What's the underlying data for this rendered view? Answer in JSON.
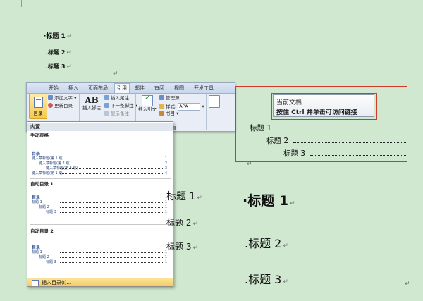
{
  "document": {
    "headings_top": [
      "标题 1",
      "标题 2",
      "标题 3"
    ],
    "headings_left": [
      "标题 1",
      "标题 2",
      "标题 3"
    ],
    "headings_right": [
      "标题 1",
      "标题 2",
      "标题 3"
    ],
    "paragraph_mark": "↵"
  },
  "ribbon": {
    "tabs": [
      "开始",
      "插入",
      "页面布局",
      "引用",
      "邮件",
      "审阅",
      "视图",
      "开发工具"
    ],
    "active_tab": "引用",
    "toc_button": "目录",
    "add_text": "添加文字",
    "update_toc": "更新目录",
    "footnote_big": "AB",
    "insert_footnote": "插入脚注",
    "insert_endnote": "插入尾注",
    "next_footnote": "下一条脚注",
    "show_notes": "显示备注",
    "insert_citation": "插入引文",
    "manage_sources": "管理源",
    "style_label": "样式:",
    "style_value": "APA",
    "bibliography": "书目",
    "group_label": "书目"
  },
  "gallery": {
    "header_builtin": "内置",
    "manual_table": "手动表格",
    "manual_title": "目录",
    "manual_lines": [
      "键入章标题(第 1 级)",
      "键入章标题(第 2 级)",
      "键入章标题(第 3 级)",
      "键入章标题(第 1 级)"
    ],
    "manual_pages": [
      "1",
      "2",
      "3",
      "4"
    ],
    "auto1": "自动目录 1",
    "auto1_title": "目录",
    "auto1_lines": [
      "标题 1",
      "标题 2",
      "标题 3"
    ],
    "auto1_pages": [
      "1",
      "1",
      "1"
    ],
    "auto2": "自动目录 2",
    "auto2_title": "目录",
    "auto2_lines": [
      "标题 1",
      "标题 2",
      "标题 3"
    ],
    "auto2_pages": [
      "1",
      "1",
      "1"
    ],
    "insert_toc": "插入目录(I)..."
  },
  "toc_right": {
    "tooltip_line1": "当前文档",
    "tooltip_line2": "按住 Ctrl 并单击可访问链接",
    "rows": [
      "标题 1",
      "标题 2",
      "标题 3"
    ],
    "accent_color": "#d23b2a"
  }
}
